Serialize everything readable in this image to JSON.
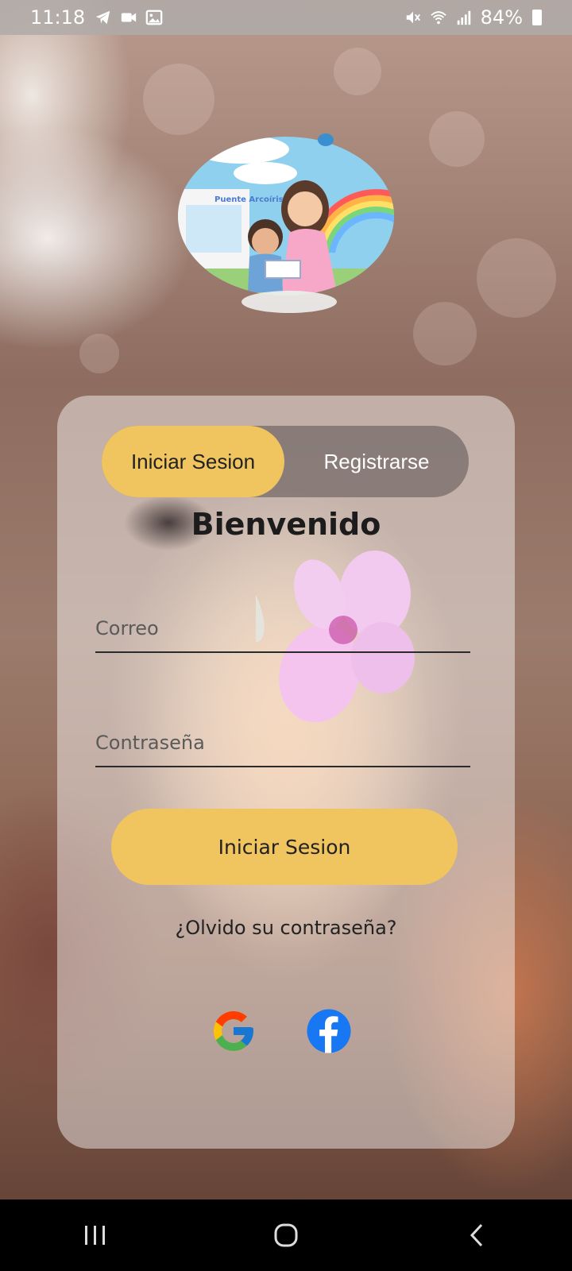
{
  "status_bar": {
    "time": "11:18",
    "battery": "84%",
    "left_icons": [
      "telegram-icon",
      "video-icon",
      "image-icon"
    ],
    "right_icons": [
      "mute-icon",
      "wifi-icon",
      "signal-icon",
      "battery-icon"
    ]
  },
  "logo": {
    "sign_text": "Puente Arcoíris"
  },
  "auth_tabs": {
    "login_label": "Iniciar Sesion",
    "register_label": "Registrarse",
    "active": "login"
  },
  "form": {
    "title": "Bienvenido",
    "email_placeholder": "Correo",
    "email_value": "",
    "password_placeholder": "Contraseña",
    "password_value": "",
    "submit_label": "Iniciar Sesion",
    "forgot_label": "¿Olvido su contraseña?"
  },
  "social": {
    "google_icon": "google-icon",
    "facebook_icon": "facebook-icon"
  },
  "nav_bar": {
    "buttons": [
      "recents-icon",
      "home-icon",
      "back-icon"
    ]
  },
  "colors": {
    "accent": "#f0c45f",
    "tab_bg": "#5a5050",
    "facebook": "#1877f2"
  }
}
